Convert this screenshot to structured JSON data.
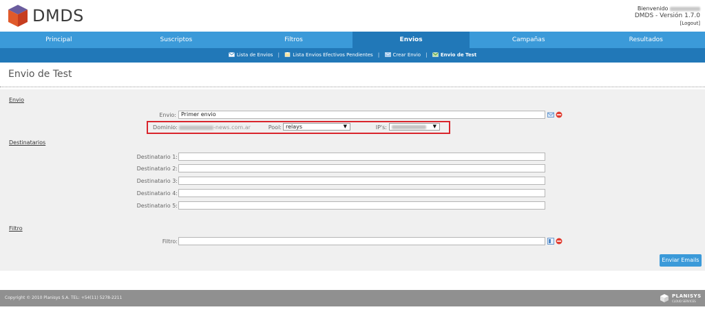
{
  "header": {
    "brand": "DMDS",
    "welcome_label": "Bienvenido",
    "version": "DMDS - Versión 1.7.0",
    "logout": "[Logout]"
  },
  "nav": {
    "items": [
      "Principal",
      "Suscriptos",
      "Filtros",
      "Envios",
      "Campañas",
      "Resultados"
    ],
    "active": "Envios"
  },
  "subnav": {
    "items": [
      "Lista de Envios",
      "Lista Envios Efectivos Pendientes",
      "Crear Envio",
      "Envio de Test"
    ],
    "separator": "|"
  },
  "page": {
    "title": "Envio de Test"
  },
  "envio": {
    "section": "Envio",
    "envio_label": "Envio:",
    "envio_value": "Primer envio",
    "dominio_label": "Dominio:",
    "dominio_value": "summitagro-news.com.ar",
    "pool_label": "Pool:",
    "pool_value": "relays",
    "ips_label": "IP's:",
    "ips_value": "131.108.41.74"
  },
  "destinatarios": {
    "section": "Destinatarios",
    "labels": [
      "Destinatario 1:",
      "Destinatario 2:",
      "Destinatario 3:",
      "Destinatario 4:",
      "Destinatario 5:"
    ]
  },
  "filtro": {
    "section": "Filtro",
    "label": "Filtro:"
  },
  "actions": {
    "submit": "Enviar Emails"
  },
  "footer": {
    "copyright": "Copyright © 2010 Planisys S.A. TEL: +54(11) 5278-2211",
    "logo_name": "PLANISYS",
    "logo_sub": "CLOUD SERVICES"
  },
  "colors": {
    "nav": "#3b9ad9",
    "nav_active": "#2178b8",
    "highlight": "#d9242b",
    "footer": "#909090"
  }
}
